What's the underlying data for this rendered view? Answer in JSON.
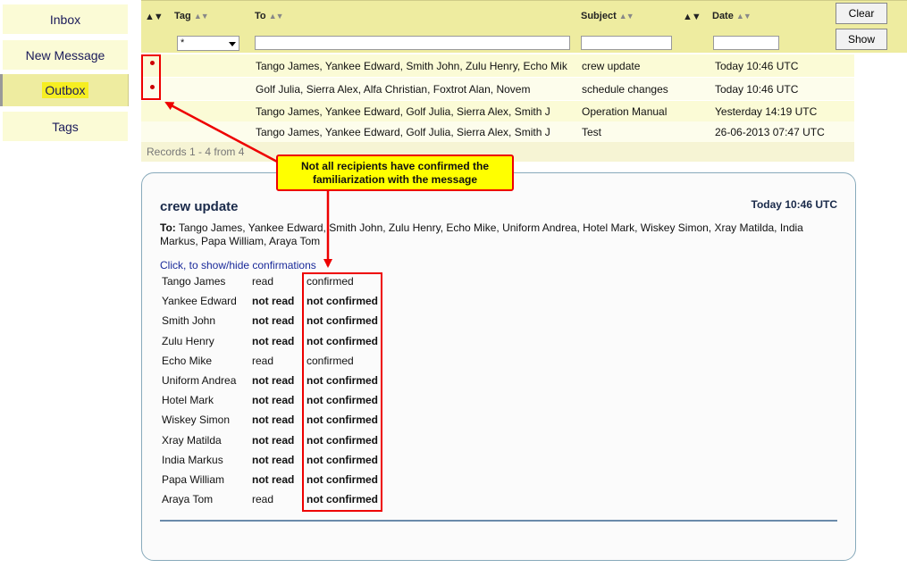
{
  "sidebar": {
    "items": [
      {
        "label": "Inbox"
      },
      {
        "label": "New Message"
      },
      {
        "label": "Outbox"
      },
      {
        "label": "Tags"
      }
    ]
  },
  "header": {
    "columns": {
      "tag": "Tag",
      "to": "To",
      "subject": "Subject",
      "date": "Date"
    },
    "tag_value": "*",
    "clear_label": "Clear",
    "show_label": "Show"
  },
  "messages": [
    {
      "to": "Tango James, Yankee Edward, Smith John, Zulu Henry, Echo Mik",
      "subject": "crew update",
      "date": "Today 10:46 UTC",
      "unconfirmed": true
    },
    {
      "to": "Golf Julia, Sierra Alex, Alfa Christian, Foxtrot Alan, Novem",
      "subject": "schedule changes",
      "date": "Today 10:46 UTC",
      "unconfirmed": true
    },
    {
      "to": "Tango James, Yankee Edward, Golf Julia, Sierra Alex, Smith J",
      "subject": "Operation Manual",
      "date": "Yesterday 14:19 UTC",
      "unconfirmed": false
    },
    {
      "to": "Tango James, Yankee Edward, Golf Julia, Sierra Alex, Smith J",
      "subject": "Test",
      "date": "26-06-2013 07:47 UTC",
      "unconfirmed": false
    }
  ],
  "records": "Records 1 - 4 from 4",
  "detail": {
    "title": "crew update",
    "date": "Today 10:46 UTC",
    "to_label": "To:",
    "to_list": "Tango James, Yankee Edward, Smith John, Zulu Henry, Echo Mike, Uniform Andrea, Hotel Mark, Wiskey Simon, Xray Matilda, India Markus, Papa William, Araya Tom",
    "toggle": "Click, to show/hide confirmations",
    "confirmations": [
      {
        "name": "Tango James",
        "read": "read",
        "status": "confirmed",
        "bold": false
      },
      {
        "name": "Yankee Edward",
        "read": "not read",
        "status": "not confirmed",
        "bold": true
      },
      {
        "name": "Smith John",
        "read": "not read",
        "status": "not confirmed",
        "bold": true
      },
      {
        "name": "Zulu Henry",
        "read": "not read",
        "status": "not confirmed",
        "bold": true
      },
      {
        "name": "Echo Mike",
        "read": "read",
        "status": "confirmed",
        "bold": false
      },
      {
        "name": "Uniform Andrea",
        "read": "not read",
        "status": "not confirmed",
        "bold": true
      },
      {
        "name": "Hotel Mark",
        "read": "not read",
        "status": "not confirmed",
        "bold": true
      },
      {
        "name": "Wiskey Simon",
        "read": "not read",
        "status": "not confirmed",
        "bold": true
      },
      {
        "name": "Xray Matilda",
        "read": "not read",
        "status": "not confirmed",
        "bold": true
      },
      {
        "name": "India Markus",
        "read": "not read",
        "status": "not confirmed",
        "bold": true
      },
      {
        "name": "Papa William",
        "read": "not read",
        "status": "not confirmed",
        "bold": true
      },
      {
        "name": "Araya Tom",
        "read": "read",
        "status": "not confirmed",
        "bold": false
      }
    ]
  },
  "callout": {
    "line1": "Not all recipients have confirmed the",
    "line2": "familiarization with the message"
  },
  "colors": {
    "header_bg": "#eeeca0",
    "row_bg": "#fbfbd6",
    "annotation": "#e00000",
    "callout_bg": "#ffff00",
    "highlight": "#f6ee22"
  },
  "icons": [
    "sort-arrows-icon",
    "dropdown-caret-icon",
    "unconfirmed-dot-icon"
  ]
}
